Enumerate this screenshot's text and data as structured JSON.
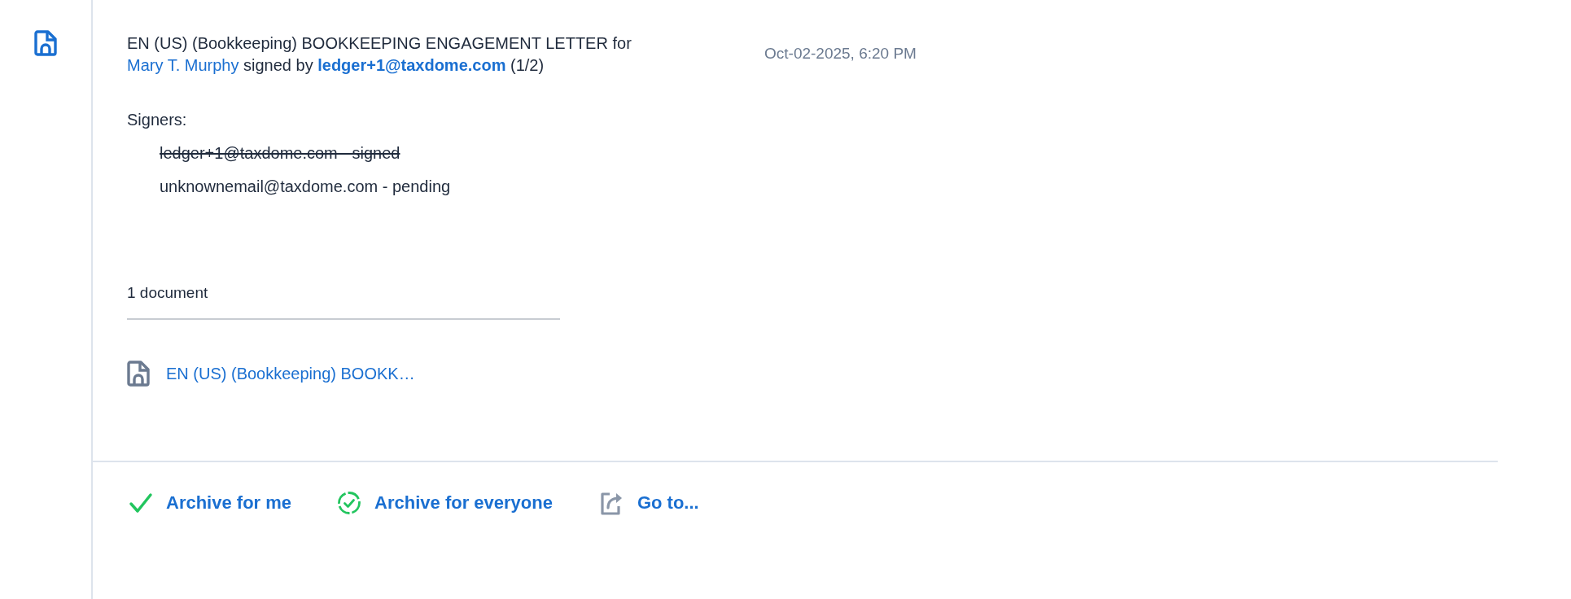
{
  "event": {
    "title": "EN (US) (Bookkeeping) BOOKKEEPING ENGAGEMENT LETTER for",
    "client": "Mary T. Murphy",
    "connector": "signed by",
    "signer": "ledger+1@taxdome.com",
    "count": "(1/2)",
    "timestamp": "Oct-02-2025, 6:20 PM"
  },
  "signers_label": "Signers:",
  "signers": [
    {
      "text": "ledger+1@taxdome.com - signed",
      "signed": true
    },
    {
      "text": "unknownemail@taxdome.com - pending",
      "signed": false
    }
  ],
  "documents": {
    "count": "1 document",
    "items": [
      {
        "name": "EN (US) (Bookkeeping) BOOKK…"
      }
    ]
  },
  "actions": [
    {
      "kind": "archive-me",
      "label": "Archive for me"
    },
    {
      "kind": "archive-all",
      "label": "Archive for everyone"
    },
    {
      "kind": "goto",
      "label": "Go to..."
    }
  ]
}
